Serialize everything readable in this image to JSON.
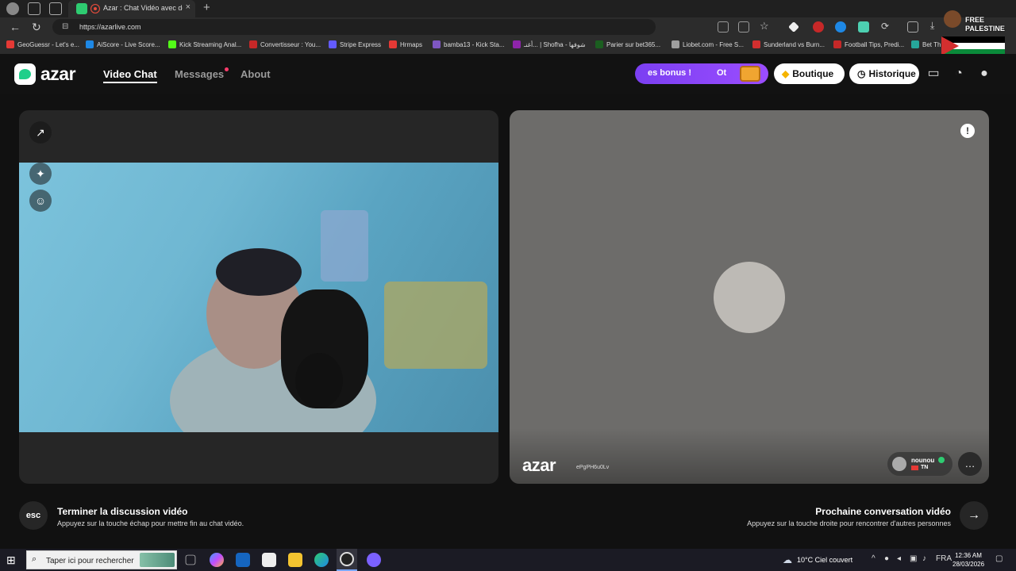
{
  "browser": {
    "tab_title": "Azar : Chat Vidéo avec de n",
    "close": "×",
    "new_tab": "+",
    "url": "https://azarlive.com",
    "bookmarks": [
      {
        "label": "GeoGuessr - Let's e...",
        "color": "#e53935"
      },
      {
        "label": "AiScore - Live Score...",
        "color": "#1e88e5"
      },
      {
        "label": "Kick Streaming Anal...",
        "color": "#53fc18"
      },
      {
        "label": "Convertisseur : You...",
        "color": "#c62828"
      },
      {
        "label": "Stripe Express",
        "color": "#635bff"
      },
      {
        "label": "Hrmaps",
        "color": "#e53935"
      },
      {
        "label": "bamba13 - Kick Sta...",
        "color": "#7e57c2"
      },
      {
        "label": "أغنـ... | Shofha - شوفها",
        "color": "#8e24aa"
      },
      {
        "label": "Parier sur bet365...",
        "color": "#1b5e20"
      },
      {
        "label": "Liobet.com - Free S...",
        "color": "#9e9e9e"
      },
      {
        "label": "Sunderland vs Burn...",
        "color": "#d32f2f"
      },
      {
        "label": "Football Tips, Predi...",
        "color": "#c62828"
      },
      {
        "label": "Bet Th",
        "color": "#26a69a"
      }
    ],
    "palestine_text": "FREE PALESTINE"
  },
  "header": {
    "logo": "azar",
    "nav": {
      "video_chat": "Video Chat",
      "messages": "Messages",
      "about": "About"
    },
    "bonus_text": "es bonus !",
    "bonus_text2": "Ot",
    "boutique": "Boutique",
    "historique": "Historique"
  },
  "left_panel": {
    "expand_icon": "↗",
    "effects_icon": "✦",
    "face_icon": "☺"
  },
  "right_panel": {
    "logo": "azar",
    "session_id": "ePgPH6u0Lv",
    "user_name": "nounou",
    "country": "TN",
    "report_icon": "!",
    "chat_icon": "…"
  },
  "footer": {
    "esc_key": "esc",
    "end_title": "Terminer la discussion vidéo",
    "end_sub": "Appuyez sur la touche échap pour mettre fin au chat vidéo.",
    "next_title": "Prochaine conversation vidéo",
    "next_sub": "Appuyez sur la touche droite pour rencontrer d'autres personnes",
    "next_arrow": "→"
  },
  "taskbar": {
    "search_placeholder": "Taper ici pour rechercher",
    "weather": "10°C  Ciel couvert",
    "lang": "FRA",
    "time": "12:36 AM",
    "date": "28/03/2026"
  }
}
